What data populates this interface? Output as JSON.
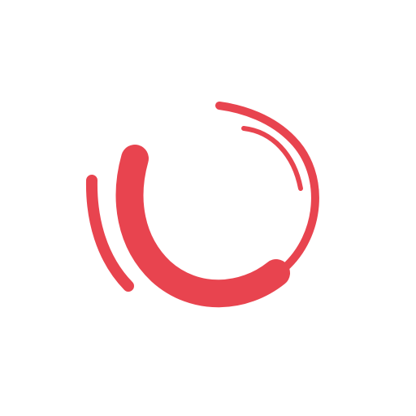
{
  "logo": {
    "icon": "swirl-circle-logo-icon",
    "brand_color": "#E8444F",
    "background_color": "#FFFFFF"
  }
}
